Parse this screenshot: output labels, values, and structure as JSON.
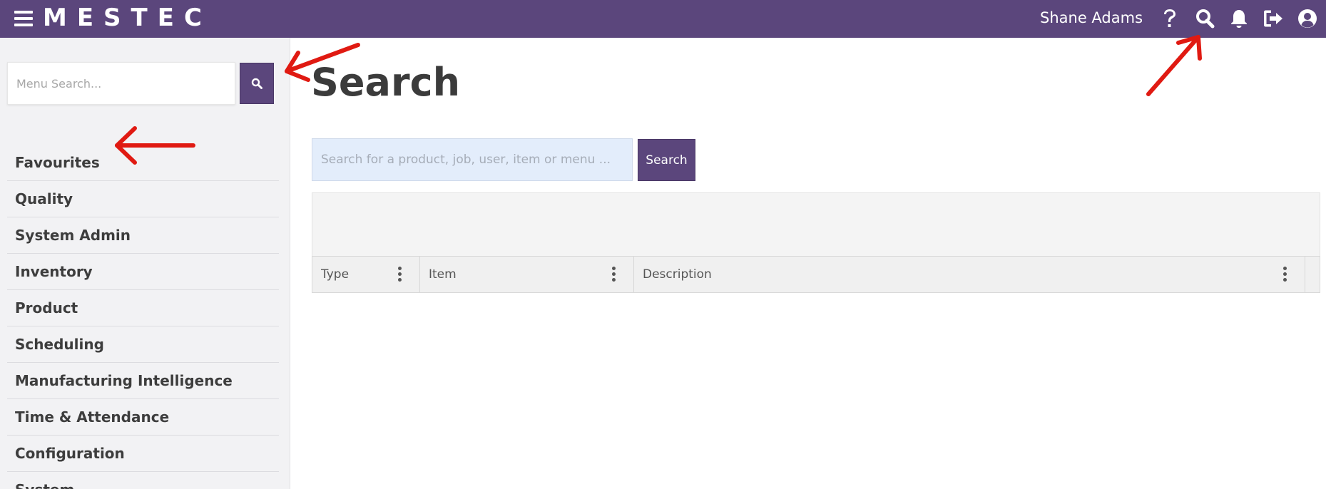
{
  "app": {
    "logo": "MESTEC",
    "user_name": "Shane Adams"
  },
  "topbar_icons": [
    "menu-icon",
    "help-icon",
    "search-icon",
    "bell-icon",
    "logout-icon",
    "user-circle-icon"
  ],
  "sidebar": {
    "search_placeholder": "Menu Search...",
    "items": [
      {
        "label": "Favourites"
      },
      {
        "label": "Quality"
      },
      {
        "label": "System Admin"
      },
      {
        "label": "Inventory"
      },
      {
        "label": "Product"
      },
      {
        "label": "Scheduling"
      },
      {
        "label": "Manufacturing Intelligence"
      },
      {
        "label": "Time & Attendance"
      },
      {
        "label": "Configuration"
      },
      {
        "label": "System"
      }
    ]
  },
  "main": {
    "title": "Search",
    "search_placeholder": "Search for a product, job, user, item or menu ...",
    "search_button": "Search",
    "table": {
      "columns": [
        "Type",
        "Item",
        "Description"
      ],
      "rows": []
    }
  },
  "colors": {
    "brand": "#5b467c",
    "annotation": "#e01a12",
    "input_bg": "#e3edfb"
  }
}
